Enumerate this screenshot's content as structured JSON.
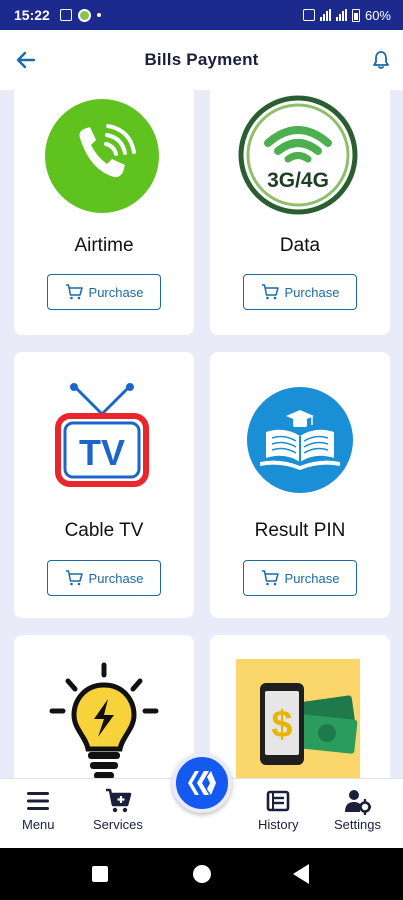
{
  "status_bar": {
    "time": "15:22",
    "battery": "60%"
  },
  "header": {
    "title": "Bills Payment",
    "back_icon": "arrow-left-icon",
    "notification_icon": "bell-icon"
  },
  "services": [
    {
      "label": "Airtime",
      "button": "Purchase",
      "icon": "phone-call-icon"
    },
    {
      "label": "Data",
      "button": "Purchase",
      "icon": "wifi-3g-4g-icon",
      "icon_text": "3G/4G"
    },
    {
      "label": "Cable TV",
      "button": "Purchase",
      "icon": "tv-icon",
      "icon_text": "TV"
    },
    {
      "label": "Result PIN",
      "button": "Purchase",
      "icon": "book-graduation-icon"
    },
    {
      "label": "",
      "button": "",
      "icon": "lightbulb-icon"
    },
    {
      "label": "",
      "button": "",
      "icon": "phone-money-icon",
      "icon_text": "$"
    }
  ],
  "bottom_nav": [
    {
      "label": "Menu",
      "icon": "menu-icon"
    },
    {
      "label": "Services",
      "icon": "cart-plus-icon"
    },
    {
      "label": "",
      "icon": "hive-logo-icon"
    },
    {
      "label": "History",
      "icon": "history-icon"
    },
    {
      "label": "Settings",
      "icon": "user-gear-icon"
    }
  ],
  "colors": {
    "status_bar": "#1b2a8c",
    "accent": "#1b6aa6",
    "fab": "#1459f0",
    "background": "#e9ebf8"
  }
}
